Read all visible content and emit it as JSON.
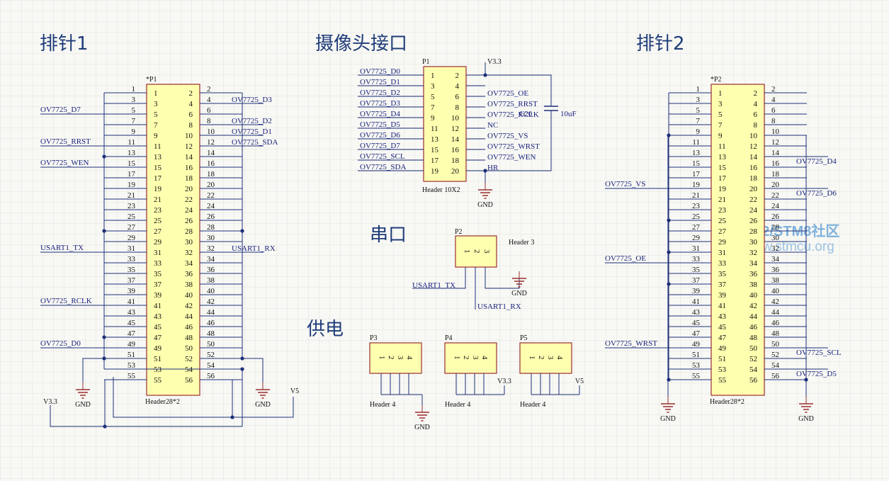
{
  "sections": {
    "header1": "排针1",
    "camera": "摄像头接口",
    "header2": "排针2",
    "serial": "串口",
    "power": "供电"
  },
  "header1": {
    "designator": "*P1",
    "footprint": "Header28*2",
    "left_labels": {
      "5": "OV7725_D7",
      "11": "OV7725_RRST",
      "15": "OV7725_WEN",
      "31": "USART1_TX",
      "41": "OV7725_RCLK",
      "49": "OV7725_D0"
    },
    "right_labels": {
      "4": "OV7725_D3",
      "8": "OV7725_D2",
      "10": "OV7725_D1",
      "12": "OV7725_SDA",
      "32": "USART1_RX"
    }
  },
  "header2": {
    "designator": "*P2",
    "footprint": "Header28*2",
    "left_labels": {
      "19": "OV7725_VS",
      "33": "OV7725_OE",
      "49": "OV7725_WRST"
    },
    "right_labels": {
      "14": "OV7725_D4",
      "20": "OV7725_D6",
      "50": "OV7725_SCL",
      "54": "OV7725_D5"
    }
  },
  "camera": {
    "designator": "P1",
    "footprint": "Header 10X2",
    "left_labels": [
      "OV7725_D0",
      "OV7725_D1",
      "OV7725_D2",
      "OV7725_D3",
      "OV7725_D4",
      "OV7725_D5",
      "OV7725_D6",
      "OV7725_D7",
      "OV7725_SCL",
      "OV7725_SDA"
    ],
    "right_labels": [
      "",
      "OV7725_OE",
      "OV7725_RRST",
      "OV7725_RCLK",
      "NC",
      "OV7725_VS",
      "OV7725_WRST",
      "OV7725_WEN",
      "HR",
      ""
    ],
    "cap_designator": "C20",
    "cap_value": "10uF"
  },
  "serial": {
    "designator": "P2",
    "footprint": "Header 3",
    "tx": "USART1_TX",
    "rx": "USART1_RX"
  },
  "power_headers": [
    {
      "designator": "P3",
      "footprint": "Header 4",
      "net": "GND"
    },
    {
      "designator": "P4",
      "footprint": "Header 4",
      "net": "V3.3"
    },
    {
      "designator": "P5",
      "footprint": "Header 4",
      "net": "V5"
    }
  ],
  "nets": {
    "gnd": "GND",
    "v33": "V3.3",
    "v5": "V5"
  },
  "watermark": {
    "line1": "STM32/STM8社区",
    "line2": "www.stmcu.org"
  },
  "colors": {
    "wire": "#1d2f7a",
    "body_fill": "#ffffb0",
    "body_stroke": "#9b2f2f",
    "power": "#9b2f2f",
    "grid": "#e2e2e2",
    "title": "#1f3c7a"
  }
}
